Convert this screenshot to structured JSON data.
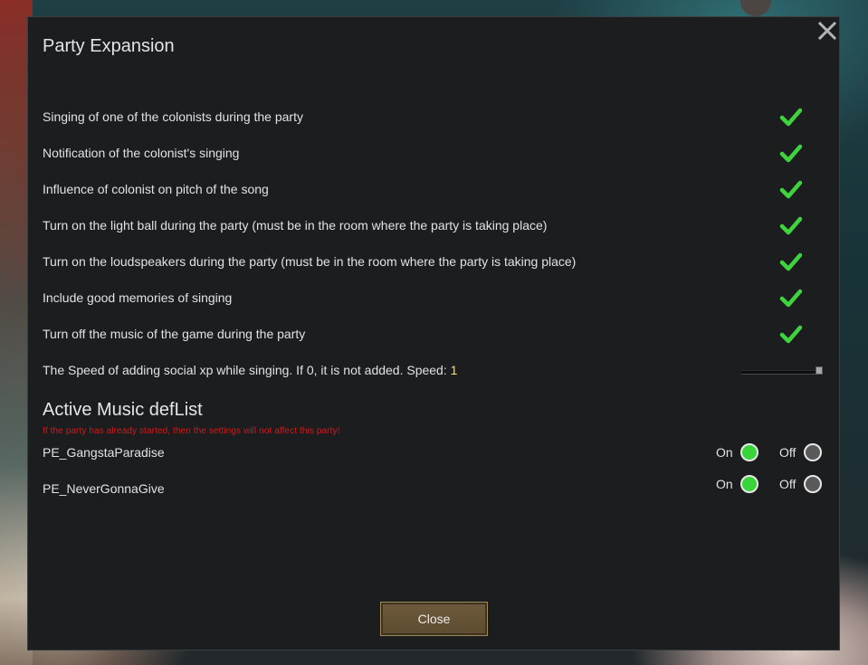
{
  "dialog": {
    "title": "Party Expansion",
    "settings": [
      {
        "label": "Singing of one of the colonists during the party",
        "checked": true
      },
      {
        "label": "Notification of the colonist's singing",
        "checked": true
      },
      {
        "label": "Influence of colonist on pitch of the song",
        "checked": true
      },
      {
        "label": "Turn on the light ball during the party (must be in the room where the party is taking place)",
        "checked": true
      },
      {
        "label": "Turn on the loudspeakers during the party (must be in the room where the party is taking place)",
        "checked": true
      },
      {
        "label": "Include good memories of singing",
        "checked": true
      },
      {
        "label": "Turn off the music of the game during the party",
        "checked": true
      }
    ],
    "speed": {
      "label": "The Speed of adding social xp while singing. If 0, it is not added. Speed: ",
      "value": "1",
      "slider_fraction": 1.0
    },
    "music_section": {
      "title": "Active Music defList",
      "warning": "If the party has already started, then the settings will not affect this party!",
      "tracks": [
        {
          "name": "PE_GangstaParadise",
          "on_label": "On",
          "off_label": "Off",
          "selected": "on"
        },
        {
          "name": "PE_NeverGonnaGive",
          "on_label": "On",
          "off_label": "Off",
          "selected": "on"
        }
      ]
    },
    "close_button_label": "Close"
  },
  "colors": {
    "check": "#3fd43f",
    "radio_on": "#39d33a",
    "radio_off": "#5a5a5a",
    "speed_value": "#ffe066",
    "warning": "#d01a1a"
  },
  "icons": {
    "close": "close-icon",
    "check": "checkmark-icon"
  }
}
